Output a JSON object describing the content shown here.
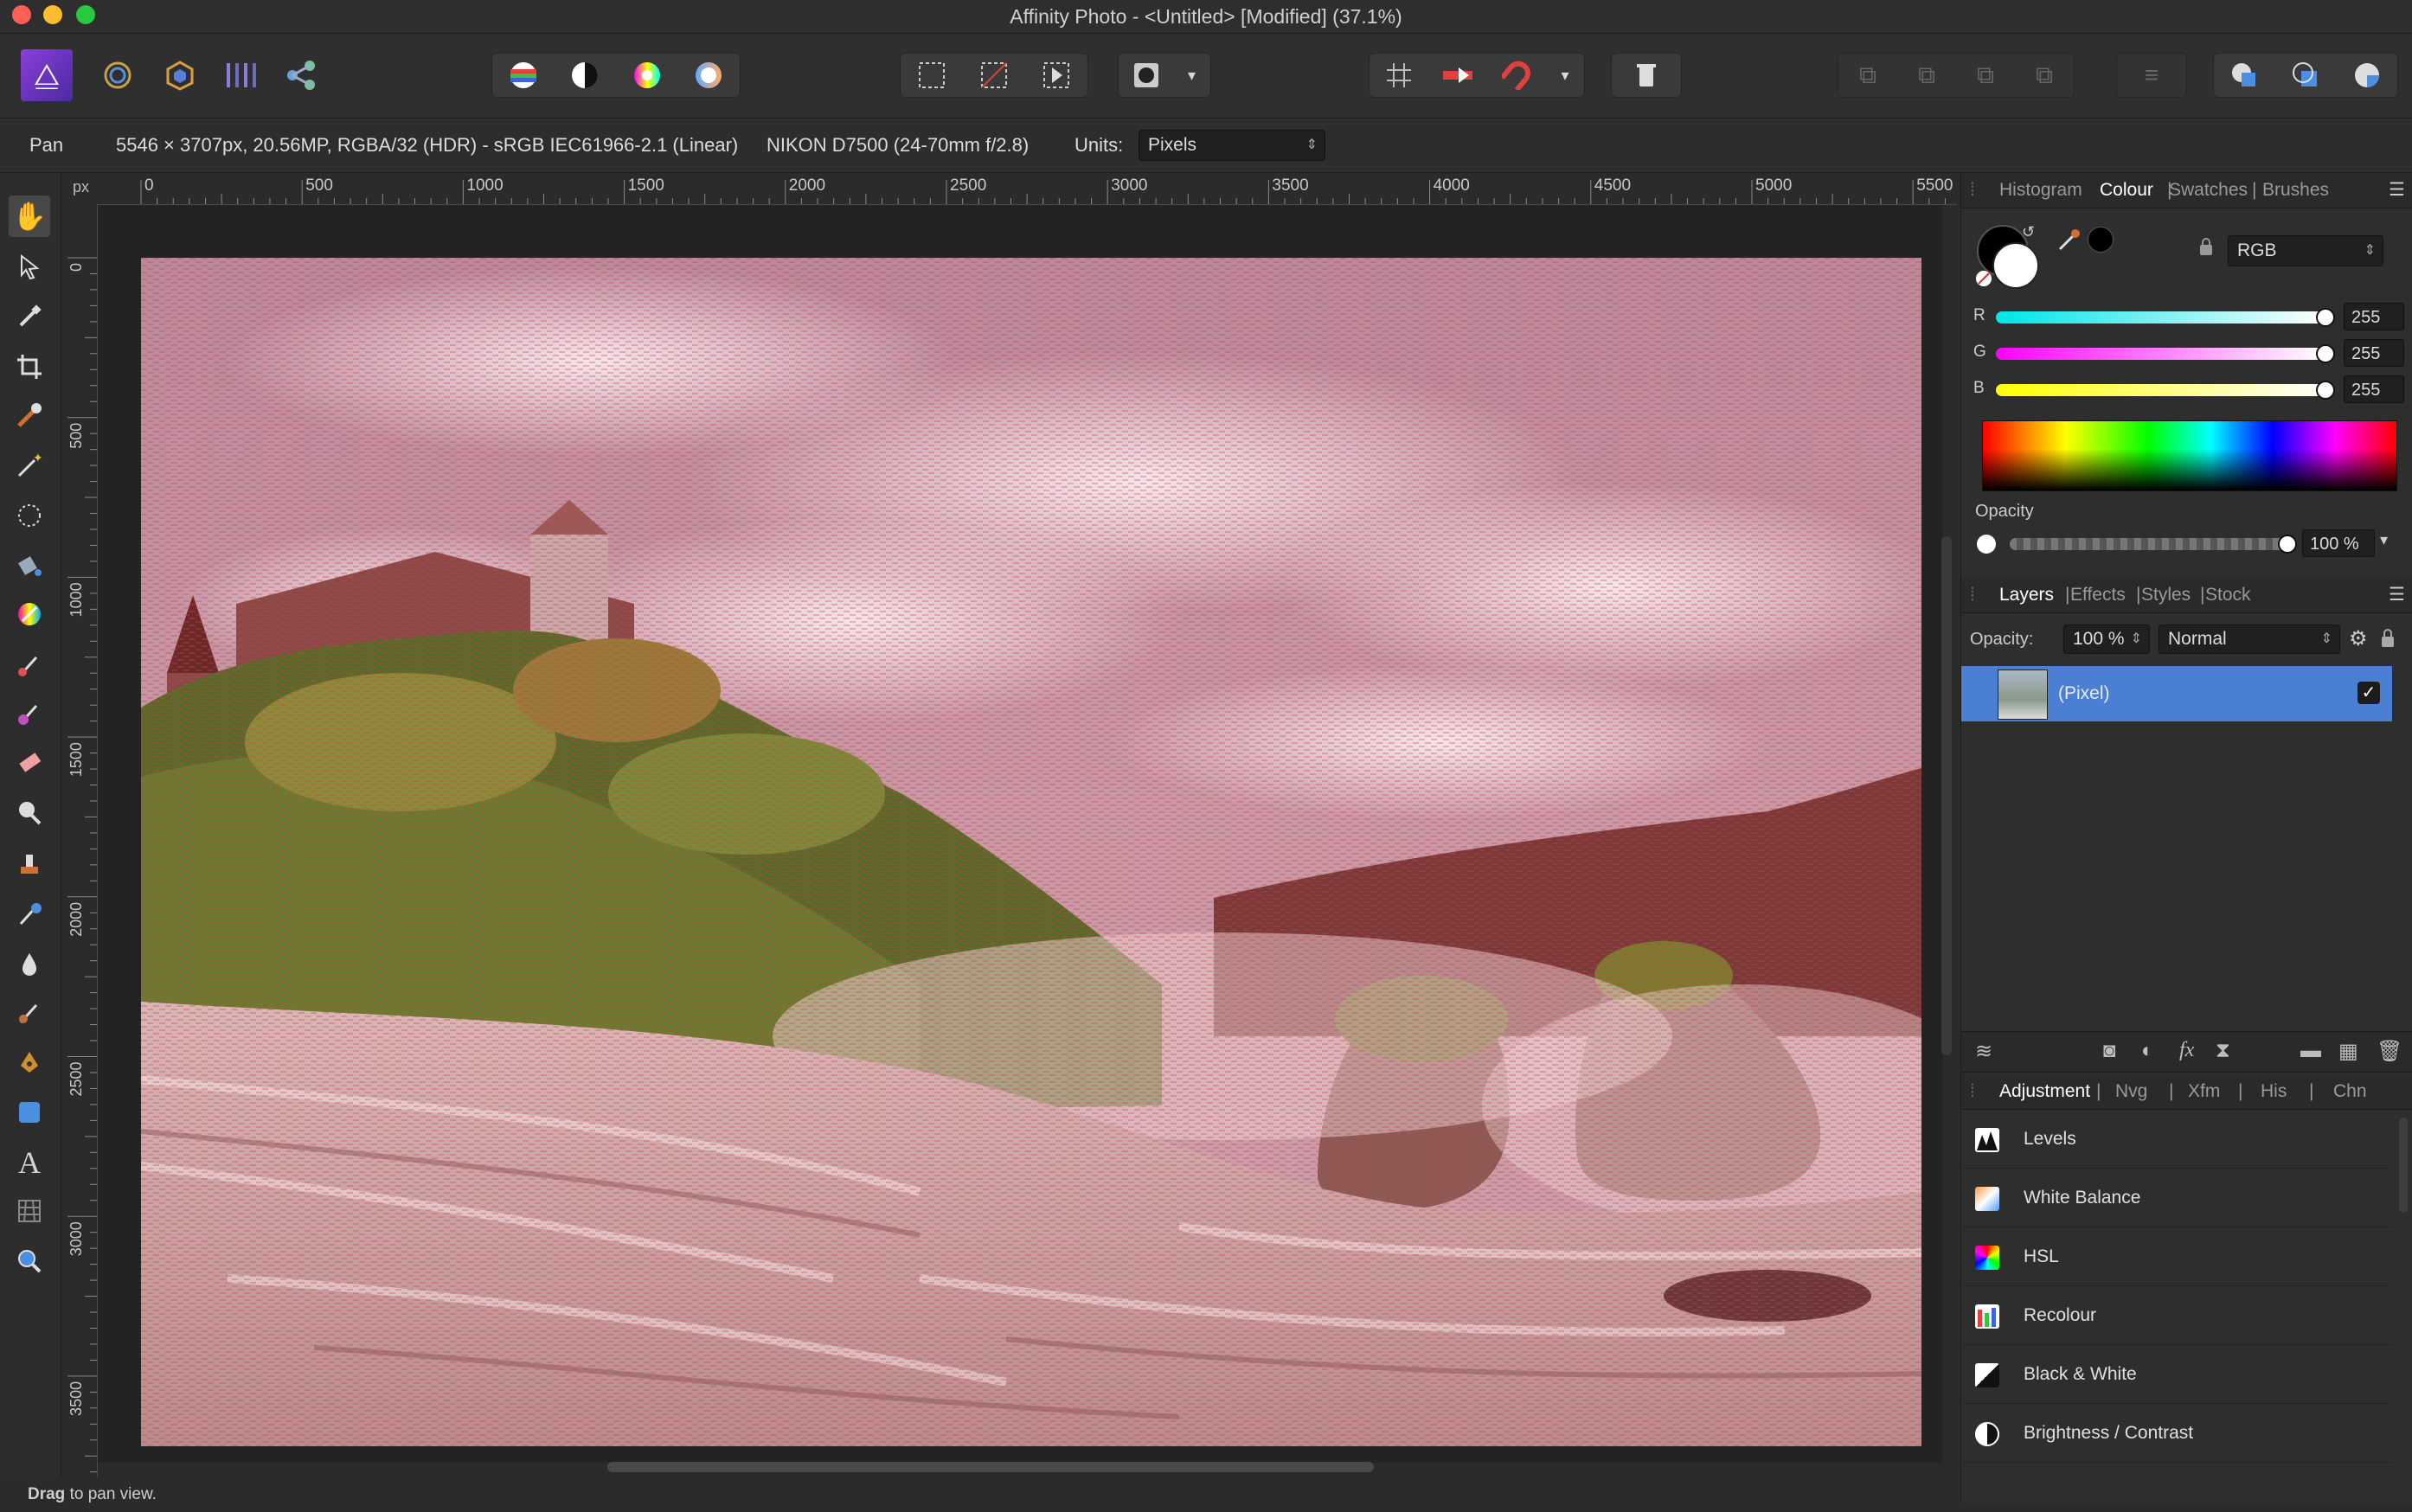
{
  "app": {
    "title": "Affinity Photo - <Untitled> [Modified] (37.1%)"
  },
  "toolbar": {
    "personas": [
      "photo-persona",
      "liquify-persona",
      "develop-persona",
      "tone-mapping-persona",
      "export-persona"
    ],
    "adjust_group": [
      "auto-levels",
      "auto-contrast",
      "auto-colours",
      "auto-white-balance"
    ],
    "selection_group": [
      "marquee",
      "no-selection",
      "invert-selection"
    ],
    "snapping_group": [
      "snapping-grid",
      "snapping-toggle",
      "magnet"
    ]
  },
  "context": {
    "tool_name": "Pan",
    "doc_info": "5546 × 3707px, 20.56MP, RGBA/32 (HDR) - sRGB IEC61966-2.1 (Linear)",
    "camera": "NIKON D7500 (24-70mm f/2.8)",
    "units_label": "Units:",
    "units_value": "Pixels"
  },
  "ruler": {
    "unit": "px",
    "h_ticks": [
      "0",
      "500",
      "1000",
      "1500",
      "2000",
      "2500",
      "3000",
      "3500",
      "4000",
      "4500",
      "5000",
      "5500"
    ],
    "v_ticks": [
      "0",
      "500",
      "1000",
      "1500",
      "2000",
      "2500",
      "3000",
      "3500"
    ]
  },
  "colour_panel": {
    "tabs": [
      "Histogram",
      "Colour",
      "Swatches",
      "Brushes"
    ],
    "active_tab": "Colour",
    "model": "RGB",
    "channels": [
      {
        "label": "R",
        "value": "255"
      },
      {
        "label": "G",
        "value": "255"
      },
      {
        "label": "B",
        "value": "255"
      }
    ],
    "opacity_label": "Opacity",
    "opacity_value": "100 %"
  },
  "layers_panel": {
    "tabs": [
      "Layers",
      "Effects",
      "Styles",
      "Stock"
    ],
    "active_tab": "Layers",
    "opacity_label": "Opacity:",
    "opacity_value": "100 %",
    "blend_mode": "Normal",
    "layers": [
      {
        "name": "(Pixel)",
        "visible": true,
        "selected": true
      }
    ]
  },
  "adjustment_panel": {
    "tabs": [
      "Adjustment",
      "Nvg",
      "Xfm",
      "His",
      "Chn"
    ],
    "active_tab": "Adjustment",
    "items": [
      "Levels",
      "White Balance",
      "HSL",
      "Recolour",
      "Black & White",
      "Brightness / Contrast"
    ]
  },
  "status": {
    "bold": "Drag",
    "text": " to pan view."
  },
  "colors": {
    "accent": "#4a7fd4",
    "bg": "#2e2e2e"
  }
}
